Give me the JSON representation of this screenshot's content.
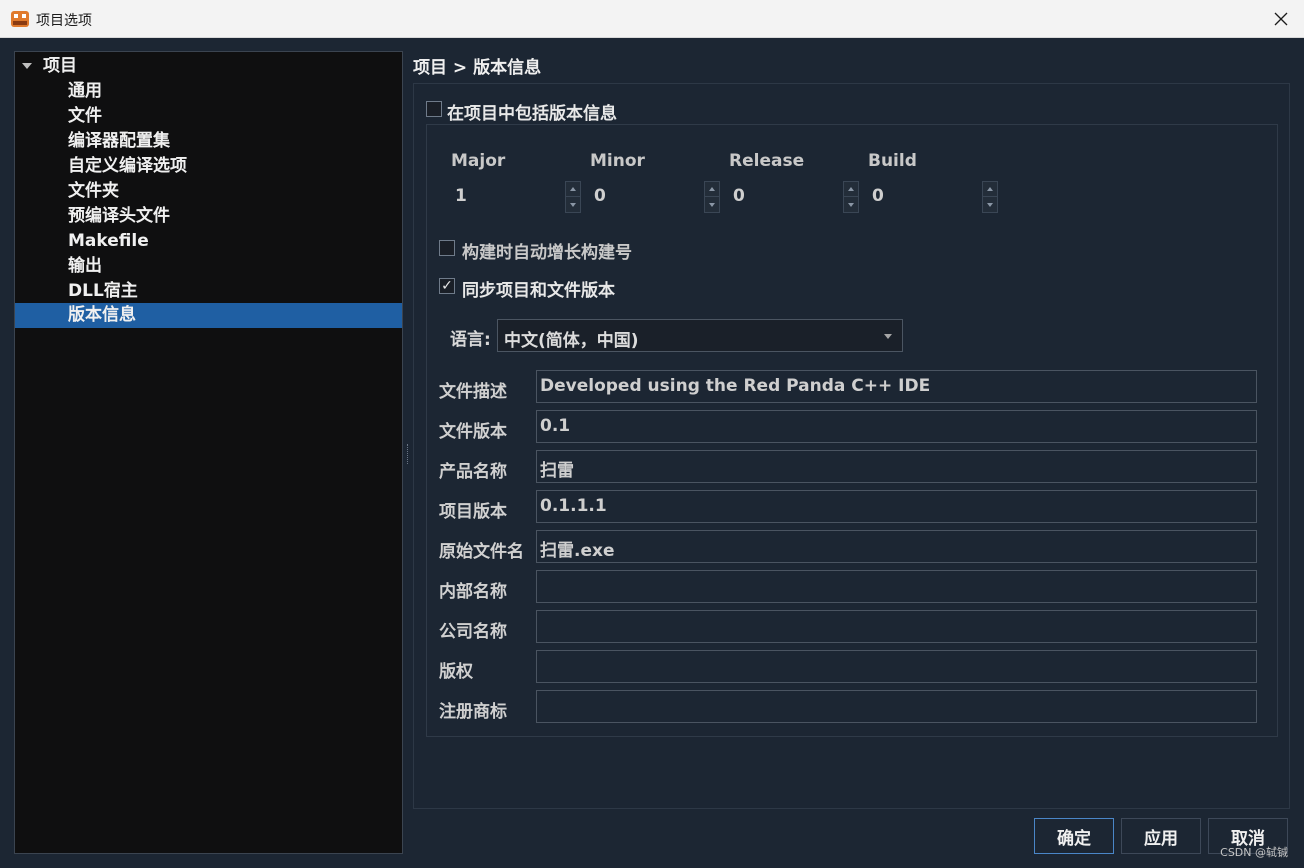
{
  "window": {
    "title": "项目选项"
  },
  "tree": {
    "root": "项目",
    "items": [
      "通用",
      "文件",
      "编译器配置集",
      "自定义编译选项",
      "文件夹",
      "预编译头文件",
      "Makefile",
      "输出",
      "DLL宿主",
      "版本信息"
    ],
    "selected_index": 9
  },
  "breadcrumb": "项目 > 版本信息",
  "include_version": {
    "label": "在项目中包括版本信息",
    "checked": false
  },
  "version": {
    "major": {
      "label": "Major",
      "value": "1"
    },
    "minor": {
      "label": "Minor",
      "value": "0"
    },
    "release": {
      "label": "Release",
      "value": "0"
    },
    "build": {
      "label": "Build",
      "value": "0"
    }
  },
  "auto_increment": {
    "label": "构建时自动增长构建号",
    "checked": false
  },
  "sync_version": {
    "label": "同步项目和文件版本",
    "checked": true,
    "mark": "✓"
  },
  "language": {
    "label": "语言:",
    "value": "中文(简体，中国)"
  },
  "fields": [
    {
      "label": "文件描述",
      "value": "Developed using the Red Panda C++ IDE"
    },
    {
      "label": "文件版本",
      "value": "0.1"
    },
    {
      "label": "产品名称",
      "value": "扫雷"
    },
    {
      "label": "项目版本",
      "value": "0.1.1.1"
    },
    {
      "label": "原始文件名",
      "value": "扫雷.exe"
    },
    {
      "label": "内部名称",
      "value": ""
    },
    {
      "label": "公司名称",
      "value": ""
    },
    {
      "label": "版权",
      "value": ""
    },
    {
      "label": "注册商标",
      "value": ""
    }
  ],
  "buttons": {
    "ok": "确定",
    "apply": "应用",
    "cancel": "取消"
  },
  "watermark": "CSDN @轼铖",
  "colors": {
    "background": "#1c2633",
    "selection": "#1f5fa3",
    "tree_bg": "#0f0f10"
  }
}
